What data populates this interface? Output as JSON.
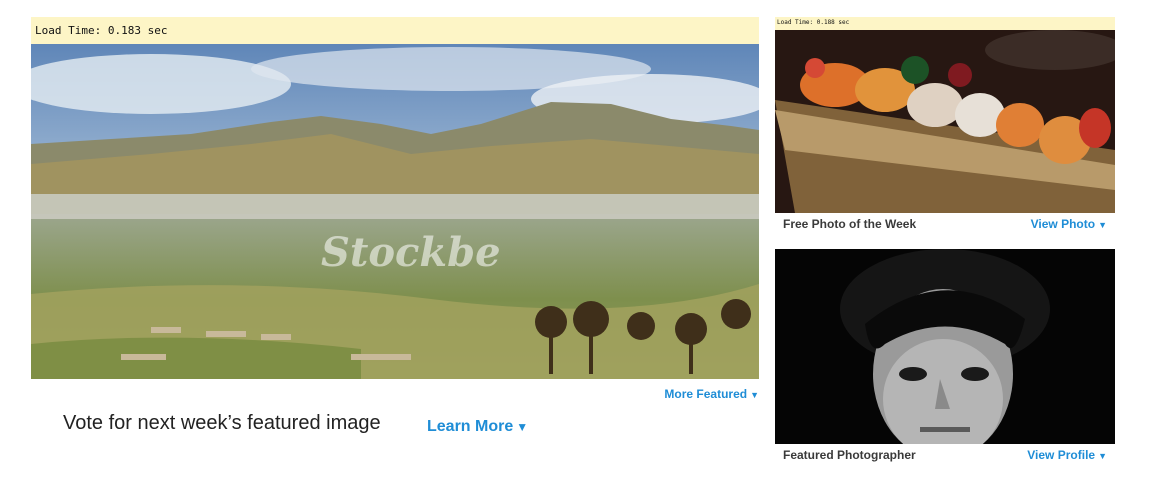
{
  "main": {
    "load_time": "Load Time: 0.183 sec",
    "hero_watermark": "Stockbe",
    "more_featured": "More Featured",
    "vote_text": "Vote for next week’s featured image",
    "learn_more": "Learn More"
  },
  "side": {
    "load_time": "Load Time: 0.188 sec",
    "photo_caption": "Free Photo of the Week",
    "view_photo": "View Photo",
    "photographer_caption": "Featured Photographer",
    "view_profile": "View Profile"
  },
  "icons": {
    "dropdown": "triangle-down-icon"
  },
  "colors": {
    "link": "#1f8dd6",
    "loadbar_bg": "#fdf5c6"
  }
}
